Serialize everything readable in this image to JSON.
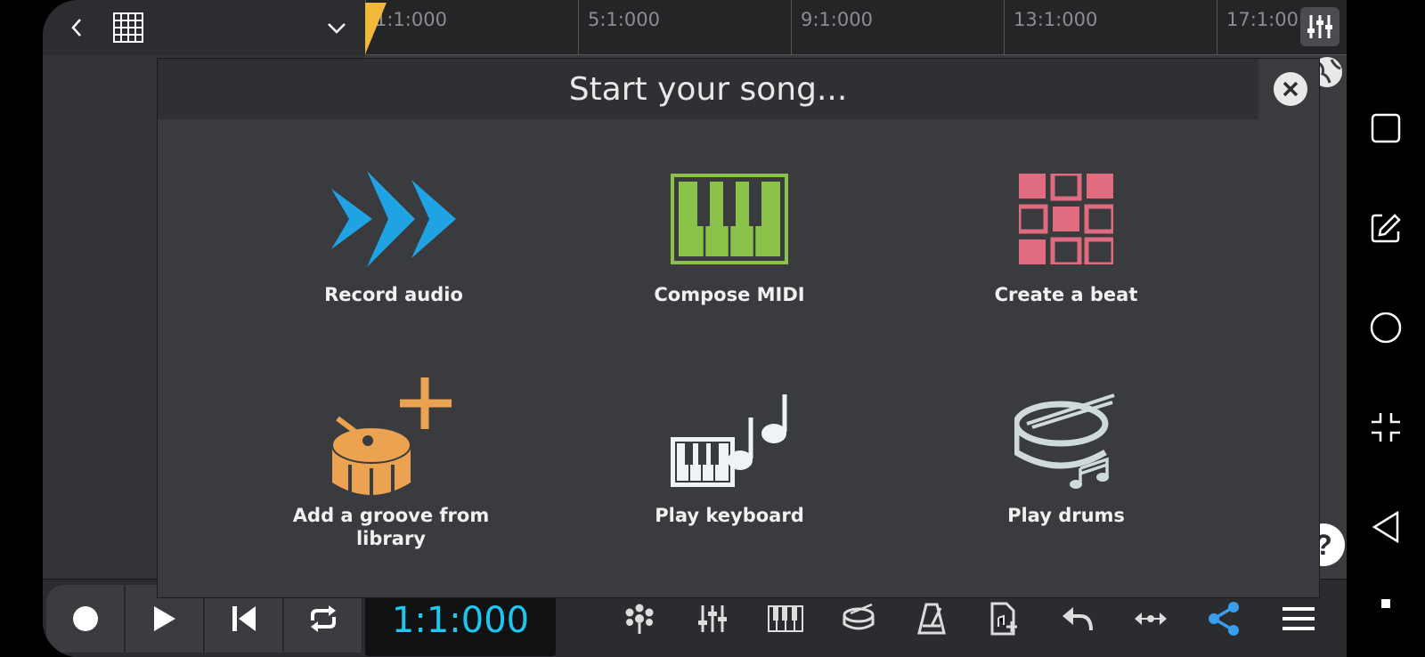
{
  "ruler": {
    "marks": [
      "1:1:000",
      "5:1:000",
      "9:1:000",
      "13:1:000",
      "17:1:00"
    ]
  },
  "transport": {
    "time": "1:1:000"
  },
  "dialog": {
    "title": "Start your song...",
    "options": [
      {
        "label": "Record audio"
      },
      {
        "label": "Compose MIDI"
      },
      {
        "label": "Create a beat"
      },
      {
        "label": "Add a groove from library"
      },
      {
        "label": "Play keyboard"
      },
      {
        "label": "Play drums"
      }
    ]
  },
  "help": {
    "label": "?"
  },
  "colors": {
    "record_audio": "#1fa3e3",
    "compose_midi": "#8bc34a",
    "create_beat": "#e06a7e",
    "add_groove": "#eba352",
    "time_display": "#1fc7ee",
    "share": "#3a9df0"
  },
  "icons": {
    "toolbar": [
      "fx-icon",
      "mixer-icon",
      "keyboard-icon",
      "drum-icon",
      "metronome-icon",
      "add-file-icon",
      "undo-icon",
      "arrows-icon",
      "share-icon",
      "menu-icon"
    ]
  }
}
